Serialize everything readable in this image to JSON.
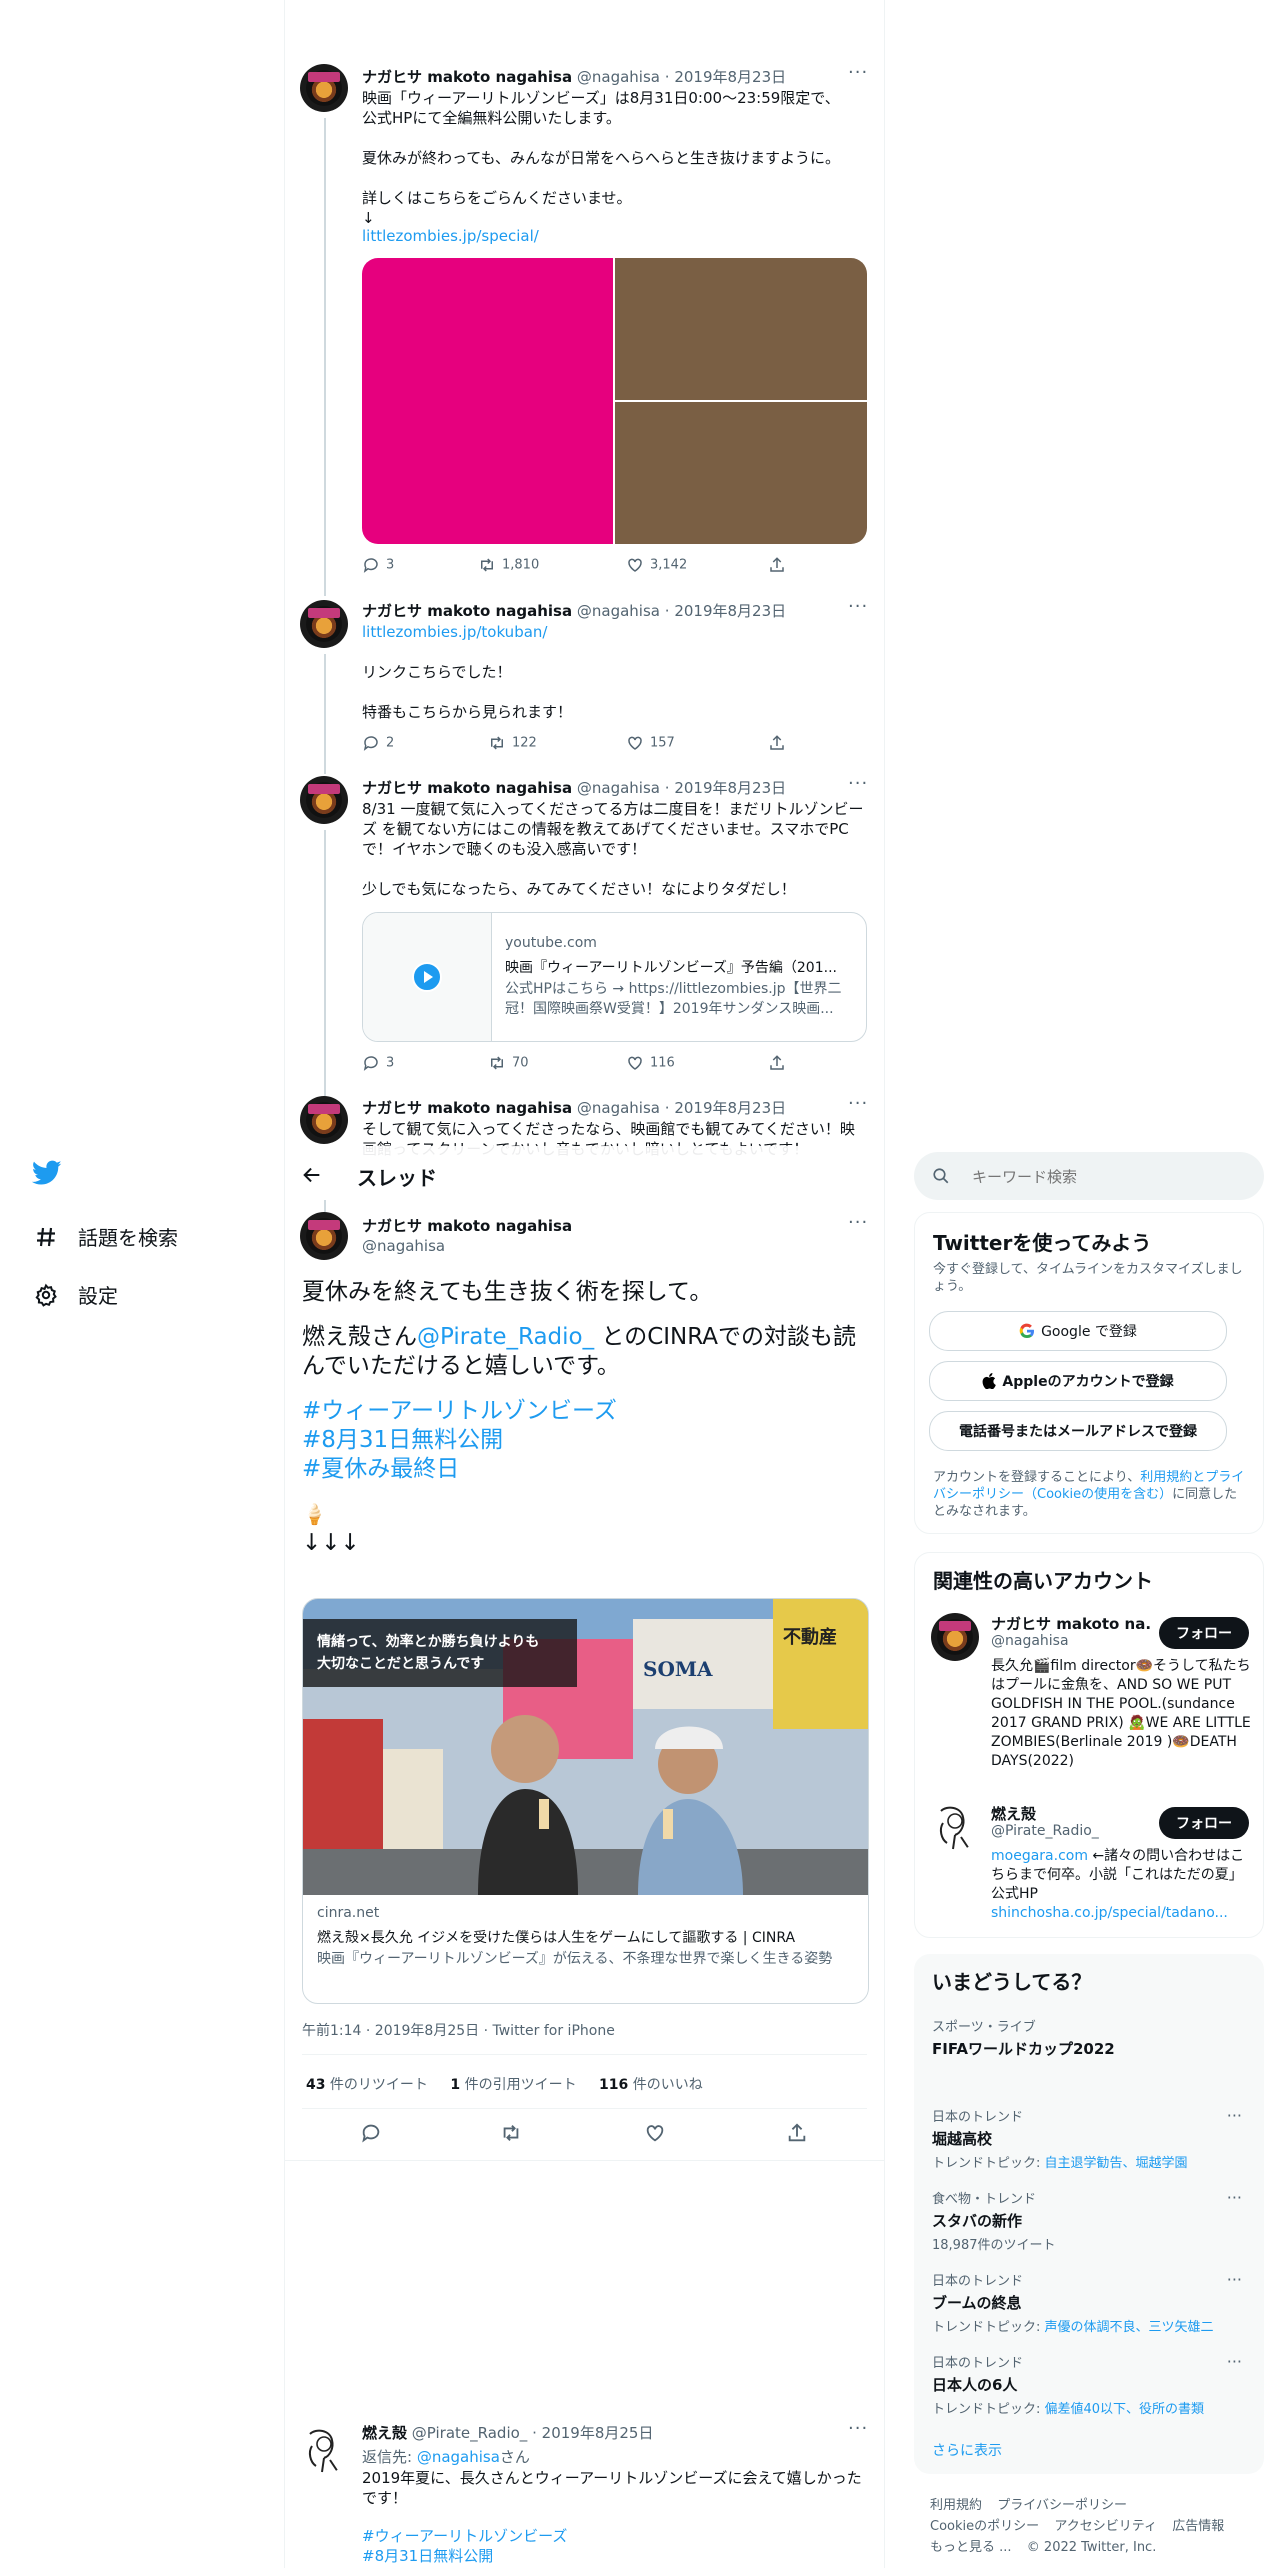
{
  "nav": {
    "explore": "話題を検索",
    "settings": "設定"
  },
  "header": {
    "title": "スレッド"
  },
  "search": {
    "placeholder": "キーワード検索"
  },
  "tweets": [
    {
      "name": "ナガヒサ makoto nagahisa",
      "handle": "@nagahisa",
      "date": "2019年8月23日",
      "text": "映画「ウィーアーリトルゾンビーズ」は8月31日0:00〜23:59限定で、\n公式HPにて全編無料公開いたします。\n\n夏休みが終わっても、みんなが日常をへらへらと生き抜けますように。\n\n詳しくはこちらをごらんくださいませ。\n↓",
      "link": "littlezombies.jp/special/",
      "replies": "3",
      "retweets": "1,810",
      "likes": "3,142"
    },
    {
      "name": "ナガヒサ makoto nagahisa",
      "handle": "@nagahisa",
      "date": "2019年8月23日",
      "link": "littlezombies.jp/tokuban/",
      "text": "リンクこちらでした！\n\n特番もこちらから見られます！",
      "replies": "2",
      "retweets": "122",
      "likes": "157"
    },
    {
      "name": "ナガヒサ makoto nagahisa",
      "handle": "@nagahisa",
      "date": "2019年8月23日",
      "text": "8/31 一度観て気に入ってくださってる方は二度目を！まだリトルゾンビーズ を観てない方にはこの情報を教えてあげてくださいませ。スマホでPCで！イヤホンで聴くのも没入感高いです！\n\n少しでも気になったら、みてみてください！なによりタダだし！",
      "card": {
        "domain": "youtube.com",
        "title": "映画『ウィーアーリトルゾンビーズ』予告編（201...",
        "desc": "公式HPはこちら → https://littlezombies.jp【世界二冠！国際映画祭W受賞！】2019年サンダンス映画..."
      },
      "replies": "3",
      "retweets": "70",
      "likes": "116"
    },
    {
      "name": "ナガヒサ makoto nagahisa",
      "handle": "@nagahisa",
      "date": "2019年8月23日",
      "text": "そして観て気に入ってくださったなら、映画館でも観てみてください！映画館ってスクリーンでかいし音もでかいし暗いしとてもよいです！"
    }
  ],
  "main_tweet": {
    "name": "ナガヒサ makoto nagahisa",
    "handle": "@nagahisa",
    "line1": "夏休みを終えても生き抜く術を探して。",
    "line2a": "燃え殻さん",
    "mention": "@Pirate_Radio_",
    "line2b": " とのCINRAでの対談も読んでいただけると嬉しいです。",
    "hashtags": [
      "#ウィーアーリトルゾンビーズ",
      "#8月31日無料公開",
      "#夏休み最終日"
    ],
    "emoji": "🍦",
    "arrows": "↓↓↓",
    "card": {
      "overlay": "情緒って、効率とか勝ち負けよりも\n大切なことだと思うんです",
      "domain": "cinra.net",
      "title": "燃え殻×長久允 イジメを受けた僕らは人生をゲームにして謳歌する | CINRA",
      "desc": "映画『ウィーアーリトルゾンビーズ』が伝える、不条理な世界で楽しく生きる姿勢",
      "storefront": "SOMA",
      "sign": "不動産"
    },
    "timestamp": "午前1:14 · 2019年8月25日 · Twitter for iPhone",
    "stats": {
      "retweets": "43",
      "retweets_label": " 件のリツイート",
      "quotes": "1",
      "quotes_label": " 件の引用ツイート",
      "likes": "116",
      "likes_label": " 件のいいね"
    }
  },
  "reply": {
    "name": "燃え殻",
    "handle": "@Pirate_Radio_",
    "date": "2019年8月25日",
    "reply_to_label": "返信先: ",
    "reply_to": "@nagahisa",
    "reply_to_suffix": "さん",
    "text": "2019年夏に、長久さんとウィーアーリトルゾンビーズに会えて嬉しかったです！",
    "hashtags": [
      "#ウィーアーリトルゾンビーズ",
      "#8月31日無料公開"
    ]
  },
  "signup": {
    "title": "Twitterを使ってみよう",
    "desc": "今すぐ登録して、タイムラインをカスタマイズしましょう。",
    "google": "Google で登録",
    "apple": "Appleのアカウントで登録",
    "phone": "電話番号またはメールアドレスで登録",
    "terms_pre": "アカウントを登録することにより、",
    "terms_link": "利用規約とプライバシーポリシー（Cookieの使用を含む）",
    "terms_post": "に同意したとみなされます。"
  },
  "related": {
    "title": "関連性の高いアカウント",
    "follow": "フォロー",
    "accounts": [
      {
        "name": "ナガヒサ makoto na...",
        "handle": "@nagahisa",
        "bio": "長久允🎬film director🍩そうして私たちはプールに金魚を、AND SO WE PUT GOLDFISH IN THE POOL.(sundance 2017 GRAND PRIX) 🧟WE ARE LITTLE ZOMBIES(Berlinale 2019 )🍩DEATH DAYS(2022)"
      },
      {
        "name": "燃え殻",
        "handle": "@Pirate_Radio_",
        "bio_link": "moegara.com",
        "bio": " ←諸々の問い合わせはこちらまで何卒。小説「これはただの夏」公式HP",
        "bio_link2": "shinchosha.co.jp/special/tadano..."
      }
    ]
  },
  "trends": {
    "title": "いまどうしてる？",
    "items": [
      {
        "category": "スポーツ・ライブ",
        "name": "FIFAワールドカップ2022",
        "sub": ""
      },
      {
        "category": "日本のトレンド",
        "name": "堀越高校",
        "sub_label": "トレンドトピック: ",
        "sub_link": "自主退学勧告、堀越学園"
      },
      {
        "category": "食べ物・トレンド",
        "name": "スタバの新作",
        "sub": "18,987件のツイート"
      },
      {
        "category": "日本のトレンド",
        "name": "ブームの終息",
        "sub_label": "トレンドトピック: ",
        "sub_link": "声優の体調不良、三ツ矢雄二"
      },
      {
        "category": "日本のトレンド",
        "name": "日本人の6人",
        "sub_label": "トレンドトピック: ",
        "sub_link": "偏差値40以下、役所の書類"
      }
    ],
    "show_more": "さらに表示"
  },
  "footer": {
    "terms": "利用規約",
    "privacy": "プライバシーポリシー",
    "cookie": "Cookieのポリシー",
    "access": "アクセシビリティ",
    "ads": "広告情報",
    "more": "もっと見る ...",
    "copyright": "© 2022 Twitter, Inc."
  },
  "colors": {
    "accent": "#1d9bf0",
    "pink": "#e6007e",
    "brown": "#7a5f44"
  }
}
